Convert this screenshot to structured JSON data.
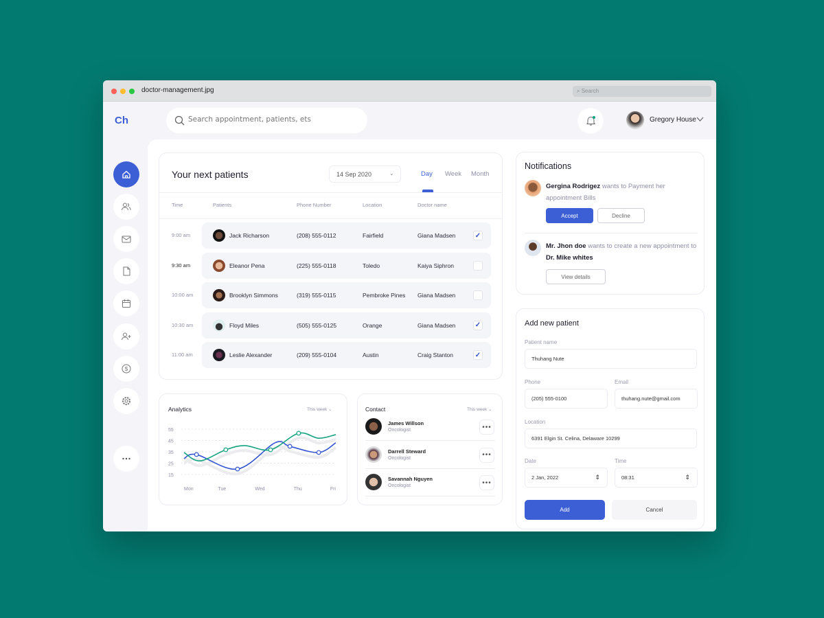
{
  "window": {
    "title": "doctor-management.jpg",
    "search_placeholder": "Search"
  },
  "header": {
    "logo": "Ch",
    "search_placeholder": "Search appointment, patients, ets",
    "user_name": "Gregory House"
  },
  "sidebar": {
    "items": [
      {
        "icon": "home-icon",
        "active": true
      },
      {
        "icon": "users-icon"
      },
      {
        "icon": "mail-icon"
      },
      {
        "icon": "document-icon"
      },
      {
        "icon": "calendar-icon"
      },
      {
        "icon": "add-user-icon"
      },
      {
        "icon": "dollar-icon"
      },
      {
        "icon": "settings-icon"
      },
      {
        "icon": "more-icon"
      }
    ]
  },
  "patients": {
    "title": "Your next patients",
    "date": "14 Sep 2020",
    "tabs": [
      "Day",
      "Week",
      "Month"
    ],
    "active_tab": "Day",
    "columns": [
      "Time",
      "Patients",
      "Phone Number",
      "Location",
      "Doctor name"
    ],
    "rows": [
      {
        "time": "9:00 am",
        "name": "Jack Richarson",
        "phone": "(208) 555-0112",
        "location": "Fairfield",
        "doctor": "Giana Madsen",
        "checked": true
      },
      {
        "time": "9:30 am",
        "name": "Eleanor Pena",
        "phone": "(225) 555-0118",
        "location": "Toledo",
        "doctor": "Kaiya Siphron",
        "checked": false
      },
      {
        "time": "10:00 am",
        "name": "Brooklyn Simmons",
        "phone": "(319) 555-0115",
        "location": "Pembroke Pines",
        "doctor": "Giana Madsen",
        "checked": false
      },
      {
        "time": "10:30 am",
        "name": "Floyd Miles",
        "phone": "(505) 555-0125",
        "location": "Orange",
        "doctor": "Giana Madsen",
        "checked": true
      },
      {
        "time": "11:00 am",
        "name": "Leslie Alexander",
        "phone": "(209) 555-0104",
        "location": "Austin",
        "doctor": "Craig Stanton",
        "checked": true
      }
    ]
  },
  "analytics": {
    "title": "Analytics",
    "period": "This week"
  },
  "chart_data": {
    "type": "line",
    "categories": [
      "Mon",
      "Tue",
      "Wed",
      "Thu",
      "Fri"
    ],
    "yticks": [
      55,
      45,
      35,
      25,
      15
    ],
    "ylim": [
      15,
      55
    ],
    "grid": true,
    "series": [
      {
        "color": "#3355d1",
        "points": [
          [
            0,
            29
          ],
          [
            0.33,
            32.6
          ],
          [
            1.41,
            19.8
          ],
          [
            2.4,
            43
          ],
          [
            2.79,
            39.8
          ],
          [
            3.55,
            34.4
          ],
          [
            4,
            43
          ]
        ],
        "markers": [
          1,
          2,
          4,
          5
        ]
      },
      {
        "color": "#13a37f",
        "points": [
          [
            0,
            34.4
          ],
          [
            0.42,
            27
          ],
          [
            1.1,
            36.8
          ],
          [
            1.6,
            40.5
          ],
          [
            2.28,
            36.8
          ],
          [
            3.02,
            51.4
          ],
          [
            3.55,
            47
          ],
          [
            4,
            50.2
          ]
        ],
        "markers": [
          2,
          4,
          5
        ]
      }
    ]
  },
  "contact": {
    "title": "Contact",
    "period": "This week",
    "items": [
      {
        "name": "James Willson",
        "role": "Oncologist"
      },
      {
        "name": "Darrell Steward",
        "role": "Oncologist"
      },
      {
        "name": "Savannah Nguyen",
        "role": "Oncologist"
      }
    ]
  },
  "notifications": {
    "title": "Notifications",
    "items": [
      {
        "name": "Gergina Rodrigez",
        "text": " wants to Payment her appointment Bills",
        "accept": "Accept",
        "decline": "Decline"
      },
      {
        "name": "Mr. Jhon doe",
        "text": " wants to create a new appointment to ",
        "target": "Dr. Mike whites",
        "view": "View details"
      }
    ]
  },
  "add_patient": {
    "title": "Add new patient",
    "name_label": "Patient name",
    "name": "Thuhang Nute",
    "phone_label": "Phone",
    "phone": "(205) 555-0100",
    "email_label": "Email",
    "email": "thuhang.nute@gmail.com",
    "location_label": "Location",
    "location": "6391 Elgin St. Celina, Delaware 10299",
    "date_label": "Date",
    "date": "2 Jan, 2022",
    "time_label": "Time",
    "time": "08:31",
    "add": "Add",
    "cancel": "Cancel"
  },
  "colors": {
    "accent": "#3d5fd6",
    "green": "#13a37f",
    "background": "#037a70"
  }
}
